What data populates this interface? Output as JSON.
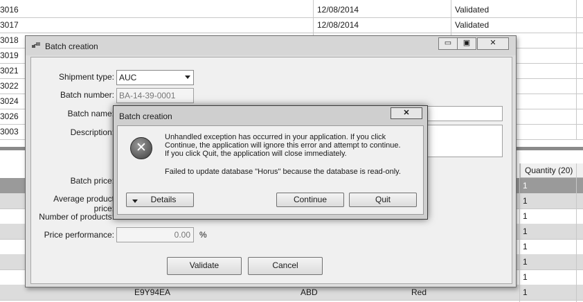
{
  "background": {
    "top_rows": [
      {
        "id": "3016",
        "date": "12/08/2014",
        "status": "Validated"
      },
      {
        "id": "3017",
        "date": "12/08/2014",
        "status": "Validated"
      },
      {
        "id": "3018",
        "date": "",
        "status": ""
      },
      {
        "id": "3019",
        "date": "",
        "status": ""
      },
      {
        "id": "3021",
        "date": "",
        "status": ""
      },
      {
        "id": "3022",
        "date": "",
        "status": ""
      },
      {
        "id": "3024",
        "date": "",
        "status": ""
      },
      {
        "id": "3026",
        "date": "",
        "status": ""
      },
      {
        "id": "3003",
        "date": "",
        "status": ""
      }
    ],
    "quantity_header": "Quantity (20)",
    "quantity_values": [
      "1",
      "1",
      "1",
      "1",
      "1",
      "1",
      "1",
      "1"
    ],
    "last_row": {
      "code": "E9Y94EA",
      "brand": "ABD",
      "color": "Red",
      "quantity": "1"
    }
  },
  "window": {
    "title": "Batch creation",
    "minimize": "▭",
    "maximize": "▣",
    "close": "✕",
    "form": {
      "shipment_type_label": "Shipment type:",
      "shipment_type_value": "AUC",
      "batch_number_label": "Batch number:",
      "batch_number_value": "BA-14-39-0001",
      "batch_name_label": "Batch name:",
      "description_label": "Description:",
      "batch_price_label": "Batch price:",
      "avg_price_label": "Average product price:",
      "num_products_label": "Number of products:",
      "price_perf_label": "Price performance:",
      "price_perf_value": "0.00",
      "price_perf_unit": "%",
      "validate_label": "Validate",
      "cancel_label": "Cancel"
    }
  },
  "dialog": {
    "title": "Batch creation",
    "close": "✕",
    "icon": "error-x-icon",
    "message_lines": [
      "Unhandled exception has occurred in your application. If you click",
      "Continue, the application will ignore this error and attempt to continue.",
      "If you click Quit, the application will close immediately."
    ],
    "detail_line": "Failed to update database \"Horus\" because the database is read-only.",
    "details_label": "Details",
    "continue_label": "Continue",
    "quit_label": "Quit"
  }
}
